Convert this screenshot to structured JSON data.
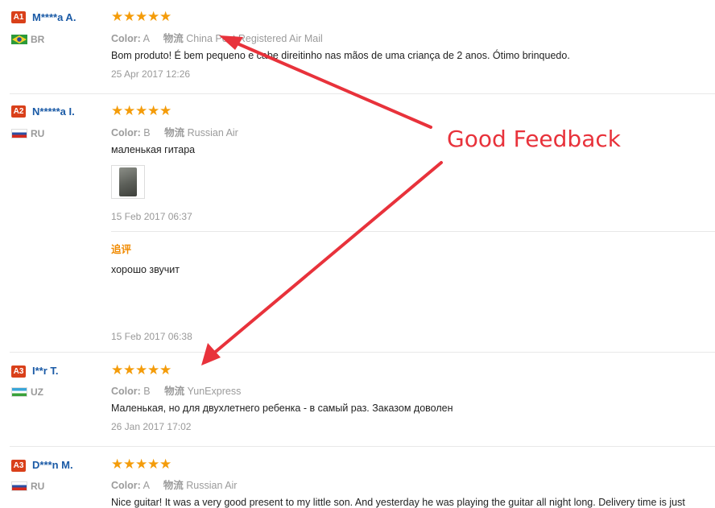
{
  "reviews": [
    {
      "badge": "A1",
      "name": "M****a A.",
      "country": "BR",
      "flag": "brazil-flag-icon",
      "color_label": "Color:",
      "color_value": "A",
      "ship_label": "物流",
      "ship_value": "China Post Registered Air Mail",
      "text": "Bom produto! É bem pequeno e cabe direitinho nas mãos de uma criança de 2 anos. Ótimo brinquedo.",
      "date": "25 Apr 2017 12:26",
      "rating": 5
    },
    {
      "badge": "A2",
      "name": "N*****a I.",
      "country": "RU",
      "flag": "russia-flag-icon",
      "color_label": "Color:",
      "color_value": "B",
      "ship_label": "物流",
      "ship_value": "Russian Air",
      "text": "маленькая гитара",
      "date": "15 Feb 2017 06:37",
      "additional_label": "追评",
      "additional_text": "хорошо звучит",
      "additional_date": "15 Feb 2017 06:38",
      "rating": 5
    },
    {
      "badge": "A3",
      "name": "I**r T.",
      "country": "UZ",
      "flag": "uzbekistan-flag-icon",
      "color_label": "Color:",
      "color_value": "B",
      "ship_label": "物流",
      "ship_value": "YunExpress",
      "text": "Маленькая, но для двухлетнего ребенка - в самый раз. Заказом доволен",
      "date": "26 Jan 2017 17:02",
      "rating": 5
    },
    {
      "badge": "A3",
      "name": "D***n M.",
      "country": "RU",
      "flag": "russia-flag-icon",
      "color_label": "Color:",
      "color_value": "A",
      "ship_label": "物流",
      "ship_value": "Russian Air",
      "text": "Nice guitar! It was a very good present to my little son. And yesterday he was playing the guitar all night long. Delivery time is just",
      "rating": 5
    }
  ],
  "annotation": {
    "text": "Good Feedback",
    "color": "#e8323b"
  },
  "colors": {
    "star": "#f49c0a",
    "badge": "#d9401a",
    "username": "#1a5aa6",
    "followup_label": "#f08a00"
  }
}
